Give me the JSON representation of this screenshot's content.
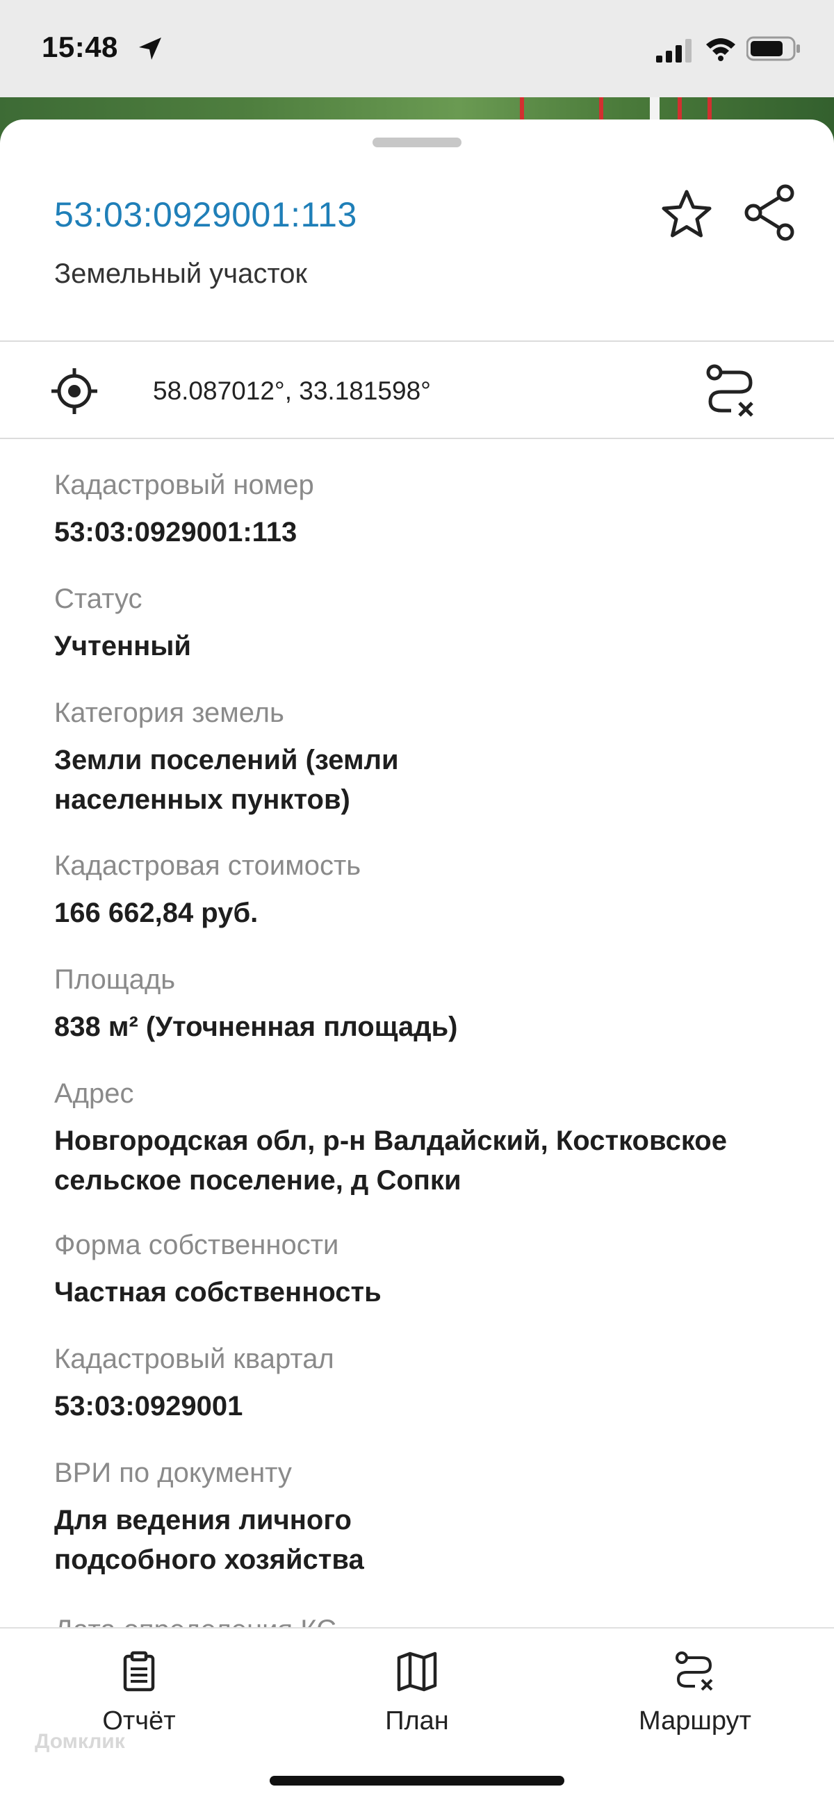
{
  "status_bar": {
    "time": "15:48",
    "location_icon": "location-arrow-icon",
    "signal_icon": "cellular-signal-icon",
    "wifi_icon": "wifi-icon",
    "battery_icon": "battery-icon"
  },
  "header": {
    "cadastral_number": "53:03:0929001:113",
    "object_type": "Земельный участок",
    "favorite_icon": "star-icon",
    "share_icon": "share-icon"
  },
  "location": {
    "coordinates": "58.087012°, 33.181598°",
    "target_icon": "target-icon",
    "route_icon": "route-icon"
  },
  "fields": [
    {
      "label": "Кадастровый номер",
      "value": "53:03:0929001:113"
    },
    {
      "label": "Статус",
      "value": "Учтенный"
    },
    {
      "label": "Категория земель",
      "value": "Земли поселений (земли населенных пунктов)"
    },
    {
      "label": "Кадастровая стоимость",
      "value": "166 662,84 руб."
    },
    {
      "label": "Площадь",
      "value": "838 м² (Уточненная площадь)"
    },
    {
      "label": "Адрес",
      "value": "Новгородская обл, р-н Валдайский, Костковское сельское поселение, д Сопки"
    },
    {
      "label": "Форма собственности",
      "value": "Частная собственность"
    },
    {
      "label": "Кадастровый квартал",
      "value": "53:03:0929001"
    },
    {
      "label": "ВРИ по документу",
      "value": "Для ведения личного подсобного хозяйства"
    }
  ],
  "partial_label": "Дата определения КС",
  "bottom_nav": [
    {
      "label": "Отчёт",
      "icon": "report-clipboard-icon"
    },
    {
      "label": "План",
      "icon": "map-icon"
    },
    {
      "label": "Маршрут",
      "icon": "route-icon"
    }
  ],
  "watermark": "Домклик",
  "colors": {
    "accent": "#1f7fb8",
    "label": "#8a8a8a",
    "value": "#1e1e1e"
  }
}
